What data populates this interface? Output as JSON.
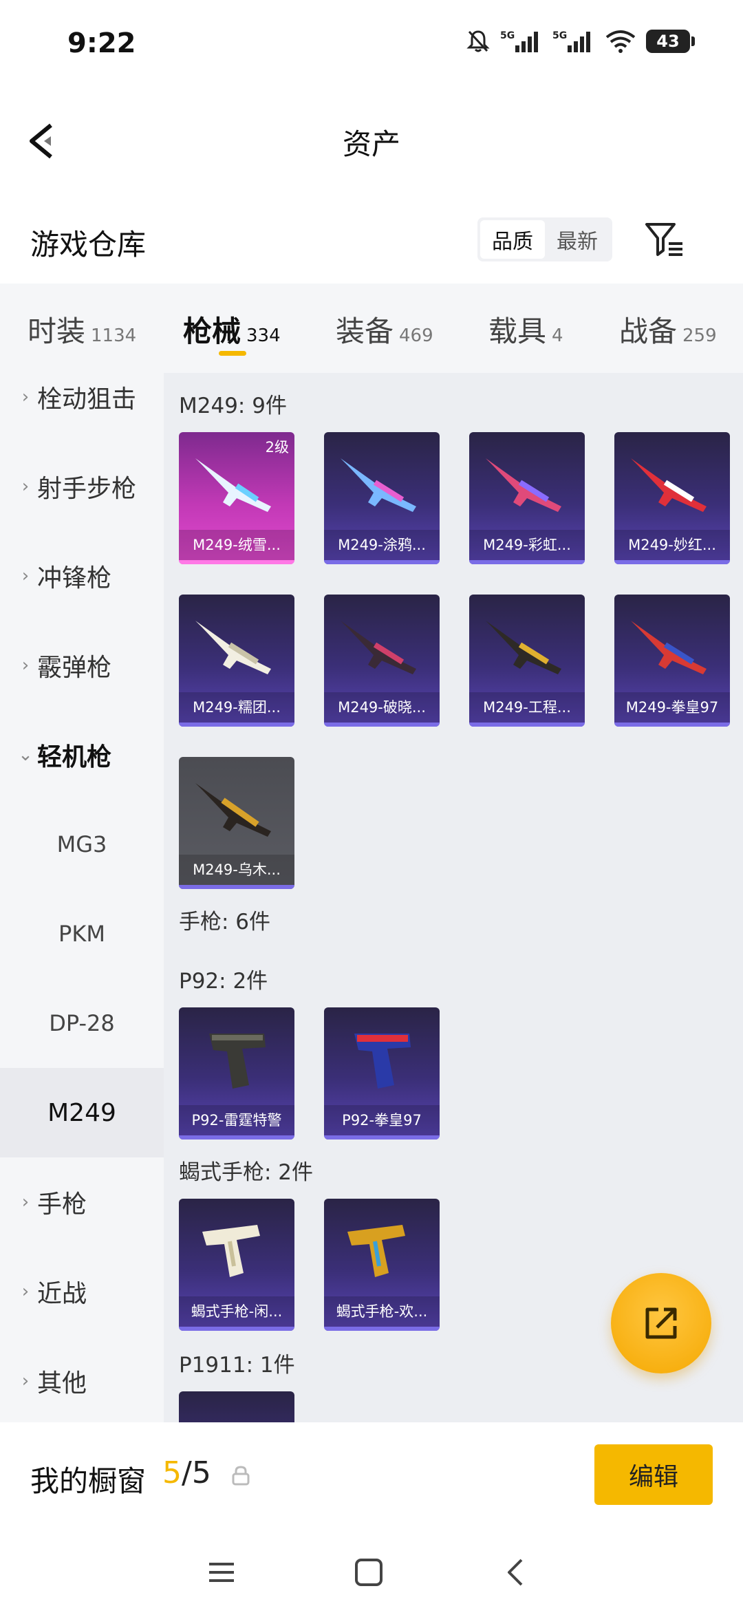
{
  "status_bar": {
    "time": "9:22",
    "battery": "43",
    "icons": [
      "bell-off-icon",
      "signal-5g-icon",
      "signal-5g-icon",
      "wifi-icon",
      "battery-icon"
    ]
  },
  "header": {
    "title": "资产"
  },
  "warehouse": {
    "title": "游戏仓库",
    "sort_options": [
      "品质",
      "最新"
    ],
    "active_sort": "品质"
  },
  "category_tabs": [
    {
      "label": "时装",
      "count": "1134"
    },
    {
      "label": "枪械",
      "count": "334",
      "active": true
    },
    {
      "label": "装备",
      "count": "469"
    },
    {
      "label": "载具",
      "count": "4"
    },
    {
      "label": "战备",
      "count": "259"
    }
  ],
  "sidebar": {
    "items": [
      {
        "label": "栓动狙击",
        "expanded": false
      },
      {
        "label": "射手步枪",
        "expanded": false
      },
      {
        "label": "冲锋枪",
        "expanded": false
      },
      {
        "label": "霰弹枪",
        "expanded": false
      },
      {
        "label": "轻机枪",
        "expanded": true
      }
    ],
    "sub_items": [
      {
        "label": "MG3"
      },
      {
        "label": "PKM"
      },
      {
        "label": "DP-28"
      },
      {
        "label": "M249",
        "active": true
      }
    ],
    "items_after": [
      {
        "label": "手枪"
      },
      {
        "label": "近战"
      },
      {
        "label": "其他"
      }
    ]
  },
  "content": {
    "groups": [
      {
        "label": "M249: 9件",
        "items": [
          {
            "name": "M249-绒雪...",
            "level": "2级",
            "tint": "pink"
          },
          {
            "name": "M249-涂鸦...",
            "tint": "purple"
          },
          {
            "name": "M249-彩虹...",
            "tint": "purple"
          },
          {
            "name": "M249-妙红...",
            "tint": "purple"
          },
          {
            "name": "M249-糯团...",
            "tint": "purple"
          },
          {
            "name": "M249-破晓...",
            "tint": "purple"
          },
          {
            "name": "M249-工程...",
            "tint": "purple"
          },
          {
            "name": "M249-拳皇97",
            "tint": "purple"
          },
          {
            "name": "M249-乌木...",
            "tint": "gray"
          }
        ]
      },
      {
        "label": "手枪: 6件",
        "items": []
      },
      {
        "label": "P92: 2件",
        "items": [
          {
            "name": "P92-雷霆特警",
            "tint": "purple"
          },
          {
            "name": "P92-拳皇97",
            "tint": "purple"
          }
        ]
      },
      {
        "label": "蝎式手枪: 2件",
        "items": [
          {
            "name": "蝎式手枪-闲...",
            "tint": "purple"
          },
          {
            "name": "蝎式手枪-欢...",
            "tint": "purple"
          }
        ]
      },
      {
        "label": "P1911: 1件",
        "items": []
      }
    ]
  },
  "showcase": {
    "label": "我的橱窗",
    "current": "5",
    "max": "/5",
    "edit_label": "编辑"
  },
  "colors": {
    "accent": "#f5b800",
    "card_purple": "#3b2f78",
    "card_pink": "#c239b6",
    "card_gray": "#5b5c63"
  }
}
